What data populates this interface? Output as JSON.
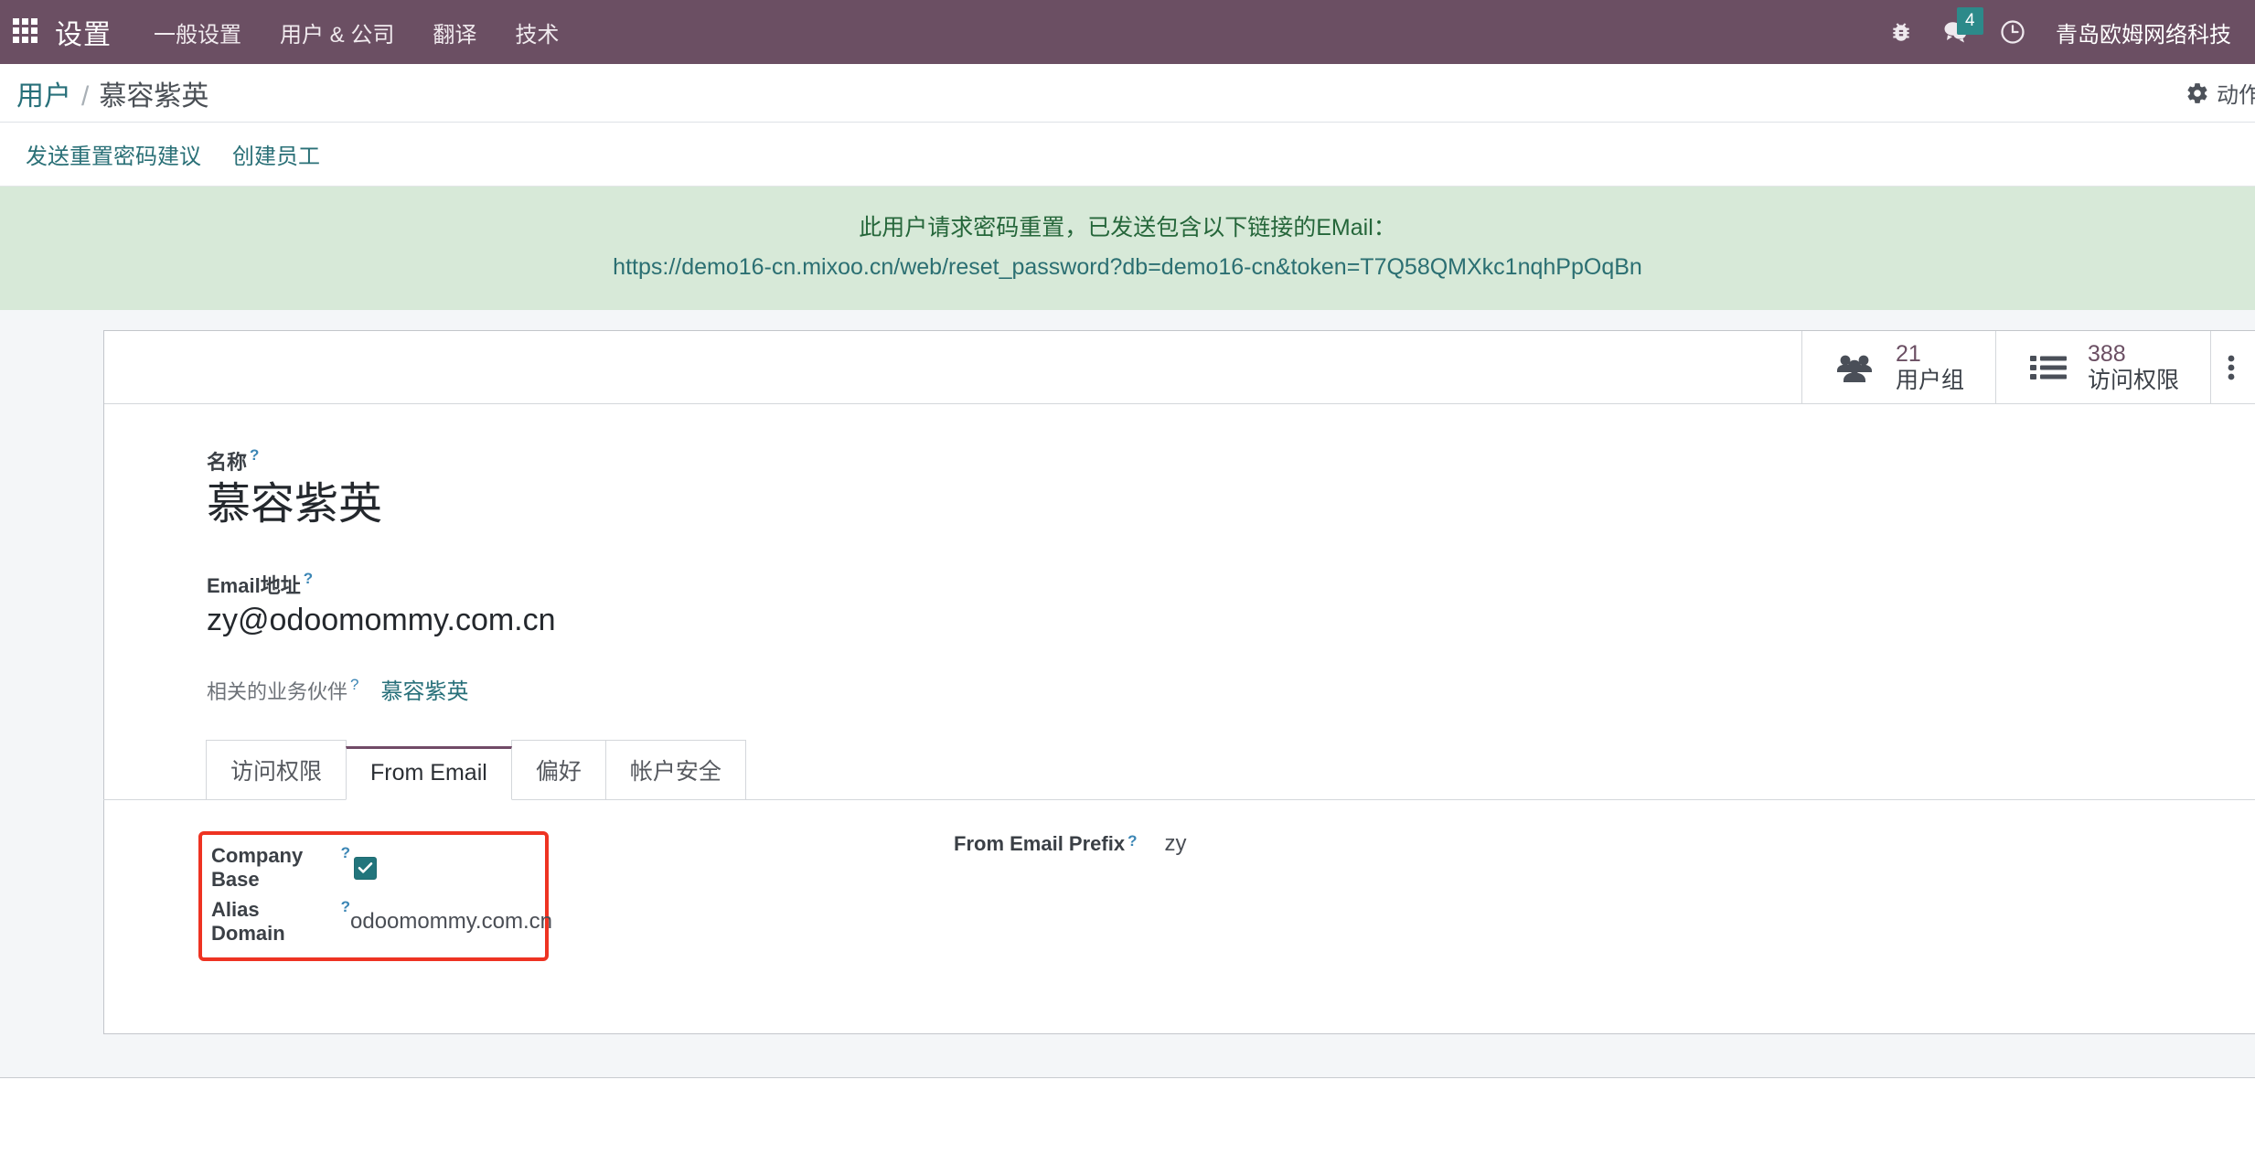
{
  "navbar": {
    "apps_icon": "apps-grid-icon",
    "brand": "设置",
    "menu": [
      {
        "label": "一般设置"
      },
      {
        "label": "用户 & 公司"
      },
      {
        "label": "翻译"
      },
      {
        "label": "技术"
      }
    ],
    "right": {
      "bug_icon": "bug-icon",
      "messages_icon": "messages-icon",
      "messages_count": "4",
      "activity_icon": "clock-icon",
      "company": "青岛欧姆网络科技"
    }
  },
  "breadcrumb": {
    "parent": "用户",
    "separator": "/",
    "current": "慕容紫英",
    "actions_label": "动作",
    "gear_icon": "gear-icon"
  },
  "button_bar": {
    "buttons": [
      {
        "label": "发送重置密码建议"
      },
      {
        "label": "创建员工"
      }
    ]
  },
  "alert": {
    "message": "此用户请求密码重置，已发送包含以下链接的EMail：",
    "url": "https://demo16-cn.mixoo.cn/web/reset_password?db=demo16-cn&token=T7Q58QMXkc1nqhPpOqBn"
  },
  "stat_buttons": [
    {
      "icon": "users-group-icon",
      "value": "21",
      "label": "用户组"
    },
    {
      "icon": "list-icon",
      "value": "388",
      "label": "访问权限"
    },
    {
      "icon": "list-dots-icon",
      "value": "",
      "label": ""
    }
  ],
  "form": {
    "name_label": "名称",
    "name_value": "慕容紫英",
    "email_label": "Email地址",
    "email_value": "zy@odoomommy.com.cn",
    "partner_label": "相关的业务伙伴",
    "partner_value": "慕容紫英",
    "tooltip_marker": "?"
  },
  "tabs": [
    {
      "label": "访问权限",
      "active": false
    },
    {
      "label": "From Email",
      "active": true
    },
    {
      "label": "偏好",
      "active": false
    },
    {
      "label": "帐户安全",
      "active": false
    }
  ],
  "tab_content": {
    "company_base_label": "Company Base",
    "company_base_checked": true,
    "alias_domain_label": "Alias Domain",
    "alias_domain_value": "odoomommy.com.cn",
    "from_email_prefix_label": "From Email Prefix",
    "from_email_prefix_value": "zy"
  },
  "colors": {
    "navbar_bg": "#6b4f63",
    "accent_purple": "#714B67",
    "link_teal": "#28707a",
    "alert_bg": "#d7e9d8",
    "alert_text": "#25663a",
    "highlight_red": "#ee3322",
    "checkbox_teal": "#22757c",
    "badge_teal": "#2c8a8a"
  }
}
